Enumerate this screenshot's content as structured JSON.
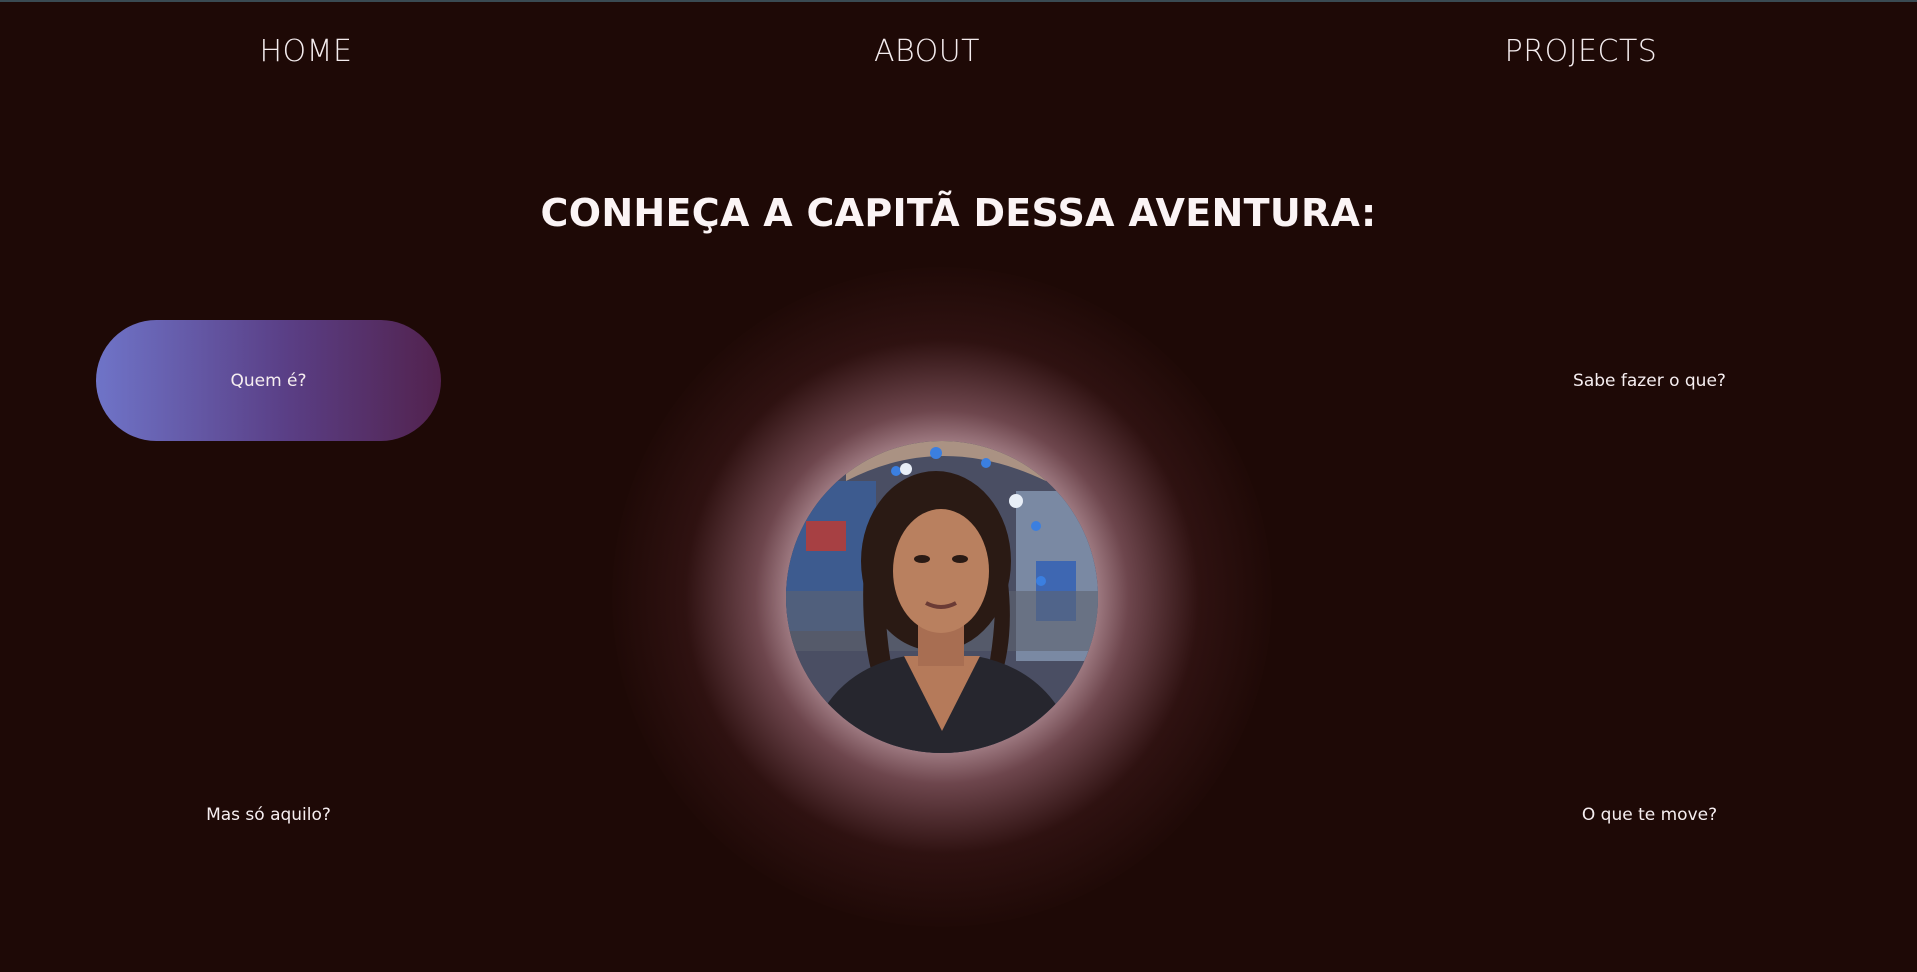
{
  "nav": {
    "home": "HOME",
    "about": "ABOUT",
    "projects": "PROJECTS"
  },
  "hero": {
    "title": "CONHEÇA A CAPITÃ DESSA AVENTURA:"
  },
  "questions": {
    "q1": "Quem é?",
    "q2": "Sabe fazer o que?",
    "q3": "Mas só aquilo?",
    "q4": "O que te move?"
  },
  "colors": {
    "background": "#1e0906",
    "active_gradient_start": "#6f74c8",
    "active_gradient_end": "#52224e",
    "glow": "#f3d8df"
  },
  "portrait": {
    "icon": "profile-photo"
  }
}
